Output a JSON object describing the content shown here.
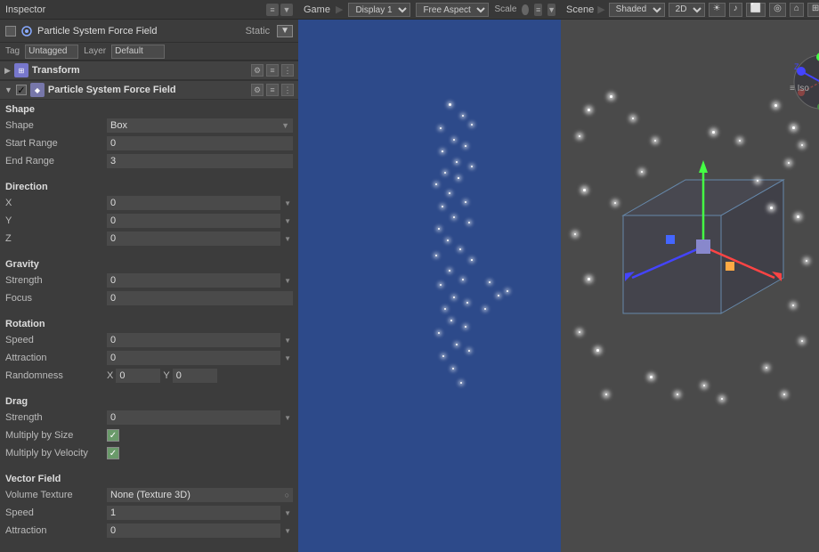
{
  "inspector": {
    "title": "Inspector",
    "panel_controls": [
      "≡",
      "▼"
    ],
    "object": {
      "enabled": true,
      "name": "Particle System Force Field",
      "static_label": "Static",
      "tag_label": "Tag",
      "tag_value": "Untagged",
      "layer_label": "Layer",
      "layer_value": "Default"
    },
    "transform": {
      "title": "Transform",
      "icon": "⊞"
    },
    "component": {
      "title": "Particle System Force Field",
      "icon": "◆"
    },
    "shape": {
      "group": "Shape",
      "fields": [
        {
          "label": "Shape",
          "type": "dropdown",
          "value": "Box"
        },
        {
          "label": "Start Range",
          "type": "number",
          "value": "0"
        },
        {
          "label": "End Range",
          "type": "number",
          "value": "3"
        }
      ]
    },
    "direction": {
      "group": "Direction",
      "fields": [
        {
          "label": "X",
          "type": "number-arrow",
          "value": "0"
        },
        {
          "label": "Y",
          "type": "number-arrow",
          "value": "0"
        },
        {
          "label": "Z",
          "type": "number-arrow",
          "value": "0"
        }
      ]
    },
    "gravity": {
      "group": "Gravity",
      "fields": [
        {
          "label": "Strength",
          "type": "number-arrow",
          "value": "0"
        },
        {
          "label": "Focus",
          "type": "number",
          "value": "0"
        }
      ]
    },
    "rotation": {
      "group": "Rotation",
      "fields": [
        {
          "label": "Speed",
          "type": "number-arrow",
          "value": "0"
        },
        {
          "label": "Attraction",
          "type": "number-arrow",
          "value": "0"
        }
      ],
      "randomness": {
        "label": "Randomness",
        "x_label": "X",
        "x_value": "0",
        "y_label": "Y",
        "y_value": "0"
      }
    },
    "drag": {
      "group": "Drag",
      "fields": [
        {
          "label": "Strength",
          "type": "number-arrow",
          "value": "0"
        },
        {
          "label": "Multiply by Size",
          "type": "checkbox",
          "value": true
        },
        {
          "label": "Multiply by Velocity",
          "type": "checkbox",
          "value": true
        }
      ]
    },
    "vector_field": {
      "group": "Vector Field",
      "fields": [
        {
          "label": "Volume Texture",
          "type": "dropdown",
          "value": "None (Texture 3D)"
        },
        {
          "label": "Speed",
          "type": "number-arrow",
          "value": "1"
        },
        {
          "label": "Attraction",
          "type": "number-arrow",
          "value": "0"
        }
      ]
    }
  },
  "game": {
    "title": "Game",
    "display_label": "Display 1",
    "aspect_label": "Free Aspect",
    "scale_label": "Scale",
    "panel_controls": [
      "≡",
      "▼"
    ]
  },
  "scene": {
    "title": "Scene",
    "shading_label": "Shaded",
    "view_label": "2D",
    "iso_label": "Iso",
    "panel_controls": [
      "≡",
      "▼"
    ],
    "controls": [
      "☀",
      "♪",
      "⬜",
      "◎",
      "⌂",
      "⊞"
    ]
  }
}
